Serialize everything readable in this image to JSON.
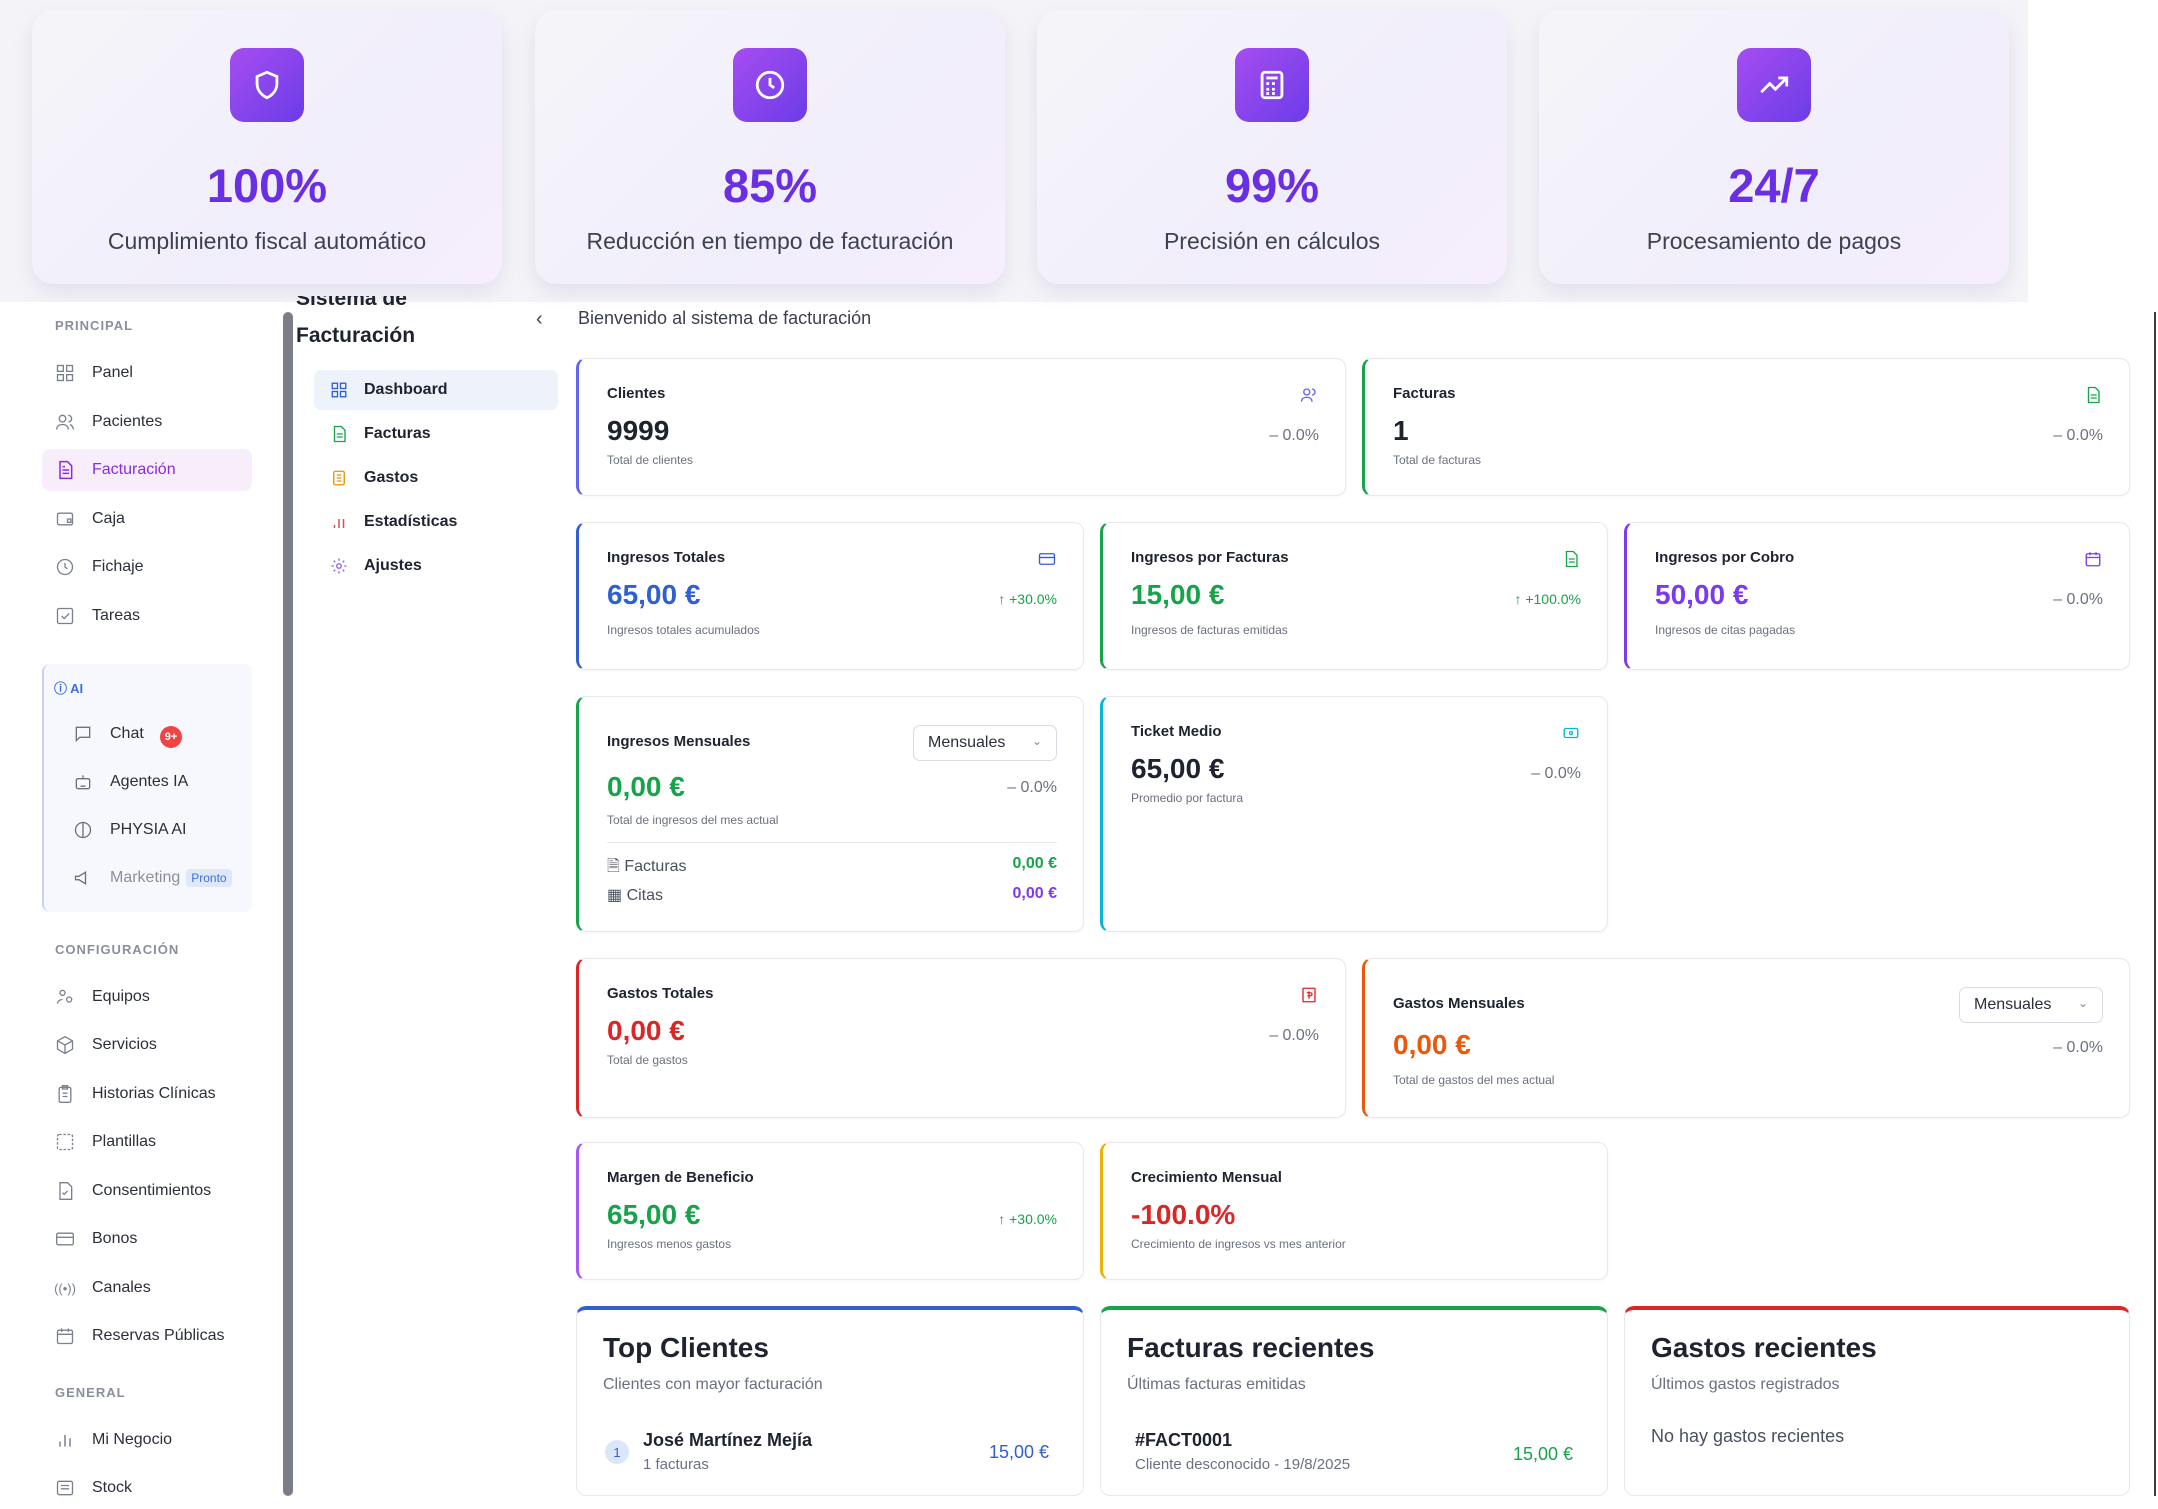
{
  "hero": [
    {
      "icon": "shield-icon",
      "value": "100%",
      "label": "Cumplimiento fiscal automático"
    },
    {
      "icon": "clock-icon",
      "value": "85%",
      "label": "Reducción en tiempo de facturación"
    },
    {
      "icon": "calculator-icon",
      "value": "99%",
      "label": "Precisión en cálculos"
    },
    {
      "icon": "trending-up-icon",
      "value": "24/7",
      "label": "Procesamiento de pagos"
    }
  ],
  "sidebar": {
    "sections": {
      "principal": "PRINCIPAL",
      "configuracion": "CONFIGURACIÓN",
      "general": "GENERAL"
    },
    "principal": [
      "Panel",
      "Pacientes",
      "Facturación",
      "Caja",
      "Fichaje",
      "Tareas"
    ],
    "ai": {
      "title": "AI",
      "chat": "Chat",
      "chat_badge": "9+",
      "agentes": "Agentes IA",
      "physia": "PHYSIA AI",
      "marketing": "Marketing",
      "pronto": "Pronto"
    },
    "configuracion": [
      "Equipos",
      "Servicios",
      "Historias Clínicas",
      "Plantillas",
      "Consentimientos",
      "Bonos",
      "Canales",
      "Reservas Públicas"
    ],
    "general": [
      "Mi Negocio",
      "Stock"
    ]
  },
  "subnav": {
    "title_top": "Sistema de",
    "title": "Facturación",
    "collapse": "‹",
    "items": [
      "Dashboard",
      "Facturas",
      "Gastos",
      "Estadísticas",
      "Ajustes"
    ]
  },
  "main": {
    "welcome": "Bienvenido al sistema de facturación",
    "clientes": {
      "title": "Clientes",
      "value": "9999",
      "sub": "Total de clientes",
      "change": "– 0.0%"
    },
    "facturas": {
      "title": "Facturas",
      "value": "1",
      "sub": "Total de facturas",
      "change": "– 0.0%"
    },
    "ingresos_totales": {
      "title": "Ingresos Totales",
      "value": "65,00 €",
      "sub": "Ingresos totales acumulados",
      "change": "↑ +30.0%"
    },
    "ingresos_facturas": {
      "title": "Ingresos por Facturas",
      "value": "15,00 €",
      "sub": "Ingresos de facturas emitidas",
      "change": "↑ +100.0%"
    },
    "ingresos_cobro": {
      "title": "Ingresos por Cobro",
      "value": "50,00 €",
      "sub": "Ingresos de citas pagadas",
      "change": "– 0.0%"
    },
    "ingresos_mensuales": {
      "title": "Ingresos Mensuales",
      "select": "Mensuales",
      "value": "0,00 €",
      "sub": "Total de ingresos del mes actual",
      "change": "– 0.0%",
      "facturas_label": "Facturas",
      "facturas_value": "0,00 €",
      "citas_label": "Citas",
      "citas_value": "0,00 €"
    },
    "ticket": {
      "title": "Ticket Medio",
      "value": "65,00 €",
      "sub": "Promedio por factura",
      "change": "– 0.0%"
    },
    "gastos_totales": {
      "title": "Gastos Totales",
      "value": "0,00 €",
      "sub": "Total de gastos",
      "change": "– 0.0%"
    },
    "gastos_mensuales": {
      "title": "Gastos Mensuales",
      "select": "Mensuales",
      "value": "0,00 €",
      "sub": "Total de gastos del mes actual",
      "change": "– 0.0%"
    },
    "margen": {
      "title": "Margen de Beneficio",
      "value": "65,00 €",
      "sub": "Ingresos menos gastos",
      "change": "↑ +30.0%"
    },
    "crecimiento": {
      "title": "Crecimiento Mensual",
      "value": "-100.0%",
      "sub": "Crecimiento de ingresos vs mes anterior"
    },
    "top_clientes": {
      "title": "Top Clientes",
      "sub": "Clientes con mayor facturación",
      "rank": "1",
      "name": "José Martínez Mejía",
      "count": "1 facturas",
      "amount": "15,00 €"
    },
    "facturas_recientes": {
      "title": "Facturas recientes",
      "sub": "Últimas facturas emitidas",
      "id": "#FACT0001",
      "meta": "Cliente desconocido - 19/8/2025",
      "amount": "15,00 €"
    },
    "gastos_recientes": {
      "title": "Gastos recientes",
      "sub": "Últimos gastos registrados",
      "empty": "No hay gastos recientes"
    }
  },
  "colors": {
    "purple": "#6b2fe3",
    "blue": "#2f5fd0",
    "green": "#16a34a",
    "red": "#dc2626",
    "orange": "#ea580c",
    "violet": "#7c3aed",
    "cyan": "#06b6d4",
    "amber": "#eab308"
  }
}
